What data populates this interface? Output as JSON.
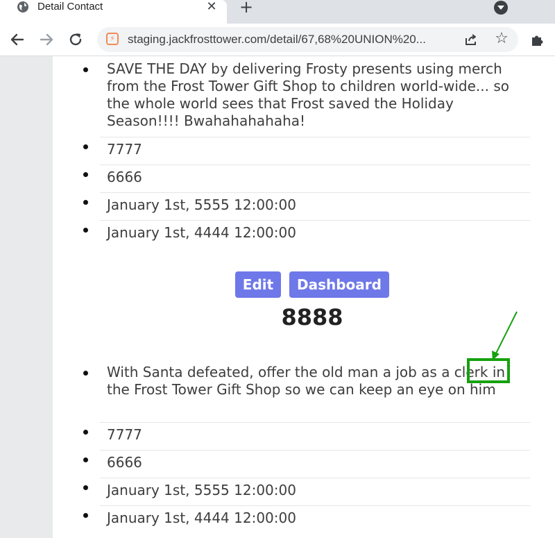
{
  "browser": {
    "tab_title": "Detail Contact",
    "tab_close": "✕",
    "new_tab": "+",
    "url": "staging.jackfrosttower.com/detail/67,68%20UNION%20...",
    "icons": [
      "globe-icon",
      "close-icon",
      "plus-icon",
      "tab-search-icon",
      "back-arrow-icon",
      "forward-arrow-icon",
      "reload-icon",
      "site-info-icon",
      "share-icon",
      "star-icon",
      "puzzle-icon"
    ]
  },
  "records": [
    {
      "items": [
        "SAVE THE DAY by delivering Frosty presents using merch from the Frost Tower Gift Shop to children world-wide... so the whole world sees that Frost saved the Holiday Season!!!! Bwahahahahaha!",
        "7777",
        "6666",
        "January 1st, 5555 12:00:00",
        "January 1st, 4444 12:00:00"
      ]
    },
    {
      "items": [
        "With Santa defeated, offer the old man a job as a clerk in the Frost Tower Gift Shop so we can keep an eye on him",
        "7777",
        "6666",
        "January 1st, 5555 12:00:00",
        "January 1st, 4444 12:00:00"
      ]
    }
  ],
  "actions": {
    "edit_label": "Edit",
    "dashboard_label": "Dashboard"
  },
  "record_heading": "8888",
  "annotation": {
    "highlighted_word": "clerk",
    "color": "#16a10e"
  },
  "colors": {
    "button": "#6f78e8",
    "text": "#3d3d3d"
  }
}
